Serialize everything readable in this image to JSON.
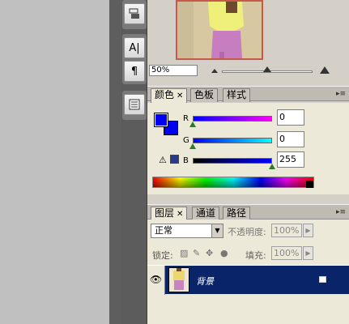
{
  "toolbar": {
    "tools": [
      {
        "icon": "layer-comps-icon"
      },
      {
        "icon": "character-icon",
        "glyph": "A|"
      },
      {
        "icon": "paragraph-icon",
        "glyph": "¶"
      },
      {
        "icon": "notes-icon"
      }
    ]
  },
  "navigator": {
    "zoom_value": "50%",
    "zoom_level": 0.5
  },
  "color_panel": {
    "tabs": [
      {
        "label": "颜色",
        "active": true,
        "closable": true
      },
      {
        "label": "色板",
        "active": false,
        "closable": false
      },
      {
        "label": "样式",
        "active": false,
        "closable": false
      }
    ],
    "foreground_color": "#0000f0",
    "background_color": "#0000f0",
    "channels": [
      {
        "label": "R",
        "value": "0"
      },
      {
        "label": "G",
        "value": "0"
      },
      {
        "label": "B",
        "value": "255"
      }
    ],
    "gamut_warning_icon": "warning-triangle-icon",
    "gamut_color": "#2a3a8c"
  },
  "layers_panel": {
    "tabs": [
      {
        "label": "图层",
        "active": true,
        "closable": true
      },
      {
        "label": "通道",
        "active": false,
        "closable": false
      },
      {
        "label": "路径",
        "active": false,
        "closable": false
      }
    ],
    "blend_mode": "正常",
    "opacity_label": "不透明度:",
    "opacity_value": "100%",
    "lock_label": "锁定:",
    "fill_label": "填充:",
    "fill_value": "100%",
    "layers": [
      {
        "name": "背景",
        "visible": true,
        "selected": true,
        "locked": true
      }
    ]
  }
}
